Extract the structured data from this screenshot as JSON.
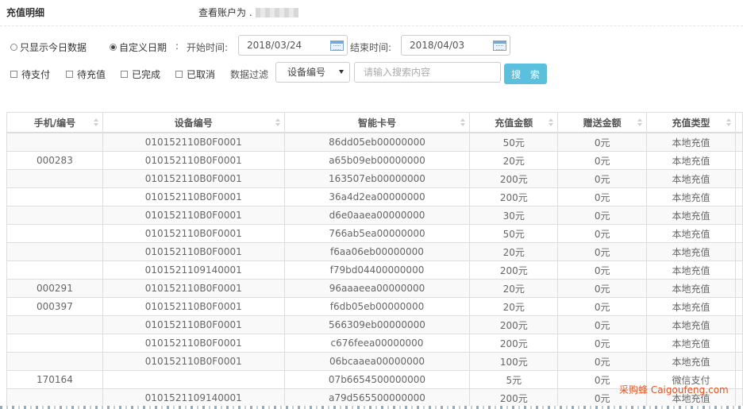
{
  "header": {
    "title": "充值明细",
    "account_label": "查看账户为 ."
  },
  "filters": {
    "radio_today": "只显示今日数据",
    "radio_custom": "自定义日期",
    "start_label": "开始时间:",
    "start_value": "2018/03/24",
    "end_label": "结束时间:",
    "end_value": "2018/04/03",
    "status_checks": [
      "待支付",
      "待充值",
      "已完成",
      "已取消"
    ],
    "data_filter_label": "数据过滤",
    "filter_field": "设备编号",
    "search_placeholder": "请输入搜索内容",
    "search_button": "搜 索"
  },
  "table": {
    "columns": [
      "手机/编号",
      "设备编号",
      "智能卡号",
      "充值金额",
      "赠送金额",
      "充值类型"
    ],
    "rows": [
      [
        "",
        "010152110B0F0001",
        "86dd05eb00000000",
        "50元",
        "0元",
        "本地充值"
      ],
      [
        "000283",
        "010152110B0F0001",
        "a65b09eb00000000",
        "20元",
        "0元",
        "本地充值"
      ],
      [
        "",
        "010152110B0F0001",
        "163507eb00000000",
        "200元",
        "0元",
        "本地充值"
      ],
      [
        "",
        "010152110B0F0001",
        "36a4d2ea00000000",
        "200元",
        "0元",
        "本地充值"
      ],
      [
        "",
        "010152110B0F0001",
        "d6e0aaea00000000",
        "30元",
        "0元",
        "本地充值"
      ],
      [
        "",
        "010152110B0F0001",
        "766ab5ea00000000",
        "50元",
        "0元",
        "本地充值"
      ],
      [
        "",
        "010152110B0F0001",
        "f6aa06eb00000000",
        "20元",
        "0元",
        "本地充值"
      ],
      [
        "",
        "0101521109140001",
        "f79bd04400000000",
        "200元",
        "0元",
        "本地充值"
      ],
      [
        "000291",
        "010152110B0F0001",
        "96aaaeea00000000",
        "20元",
        "0元",
        "本地充值"
      ],
      [
        "000397",
        "010152110B0F0001",
        "f6db05eb00000000",
        "20元",
        "0元",
        "本地充值"
      ],
      [
        "",
        "010152110B0F0001",
        "566309eb00000000",
        "200元",
        "0元",
        "本地充值"
      ],
      [
        "",
        "010152110B0F0001",
        "c676feea00000000",
        "200元",
        "0元",
        "本地充值"
      ],
      [
        "",
        "010152110B0F0001",
        "06bcaaea00000000",
        "100元",
        "0元",
        "本地充值"
      ],
      [
        "170164",
        "",
        "07b6654500000000",
        "5元",
        "0元",
        "微信支付"
      ],
      [
        "",
        "0101521109140001",
        "a79d565500000000",
        "200元",
        "0元",
        "本地充值"
      ]
    ]
  },
  "watermark": "采购蜂 Caigoufeng.com"
}
